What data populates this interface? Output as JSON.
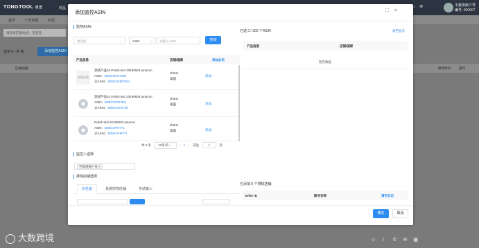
{
  "app": {
    "logo": "TONGTOOL",
    "logo_sub": "通途",
    "nav_item": "商品",
    "user_name": "不晨夜账户号",
    "user_id": "编号: 000007",
    "tabs": [
      "首页",
      "广告管理",
      "利润"
    ],
    "filter_placeholder": "请选择店铺/站点、可多选",
    "selected_count": "选中 0 / 共 条",
    "bulk_button": "添加监控ASIN",
    "table_header_store": "店铺/国家",
    "table_header_update": "更新时间",
    "table_header_action": "操作",
    "watermark": "大数跨境"
  },
  "modal": {
    "title": "添加监控ASIN",
    "section_asin": "监控ASIN",
    "store_select_placeholder": "请选择",
    "type_select_value": "ASIN",
    "asin_input_placeholder": "请输入ASIN",
    "search_button": "查询",
    "left_table": {
      "col_product": "产品信息",
      "col_store": "店铺/国家",
      "col_add_page": "添加此页",
      "rows": [
        {
          "thumb_text": "加载失败",
          "title": "测试产品02 Pulish test 20190826 amazon",
          "asin_label": "ASIN：",
          "asin": "B0BXSFMTWN",
          "sasin_label": "父ASIN：",
          "sasin": "B0BXSFMTWN",
          "store": "zhtest",
          "country": "美国",
          "action": "添加"
        },
        {
          "thumb_text": "",
          "title": "测试产品01 Pulish test 20190826 amazon",
          "asin_label": "ASIN：",
          "asin": "B0BXSGSF3K1",
          "sasin_label": "父ASIN：",
          "sasin": "B0BXSGSF3K",
          "store": "zhtest",
          "country": "美国",
          "action": "添加"
        },
        {
          "thumb_text": "",
          "title": "Pulish test 20190826 amazon",
          "asin_label": "ASIN：",
          "asin": "B0BXSFMT71",
          "sasin_label": "父ASIN：",
          "sasin": "B0BXSFMT7I",
          "store": "zhtest",
          "country": "美国",
          "action": "添加"
        }
      ]
    },
    "pagination": {
      "total": "共 8 条",
      "page_size": "20条/页",
      "prev": "‹",
      "current": "1",
      "next": "›",
      "goto": "前往",
      "goto_value": "1",
      "page_unit": "页"
    },
    "right_panel": {
      "selected_text": "已选 0 / 300 个ASIN",
      "clear_link": "清空此页",
      "col_product": "产品信息",
      "col_store": "店铺/国家",
      "empty": "暂无数据"
    },
    "section_monitor": "监控人选择",
    "monitor_tag": "不晨夜账户号",
    "section_exclude": "排除店铺选择",
    "exclude_tabs": [
      "白名单",
      "系统授权店铺",
      "手动输入"
    ],
    "exclude_right": {
      "added_text": "已添加 0 个排除店铺",
      "col_seller": "Seller ID",
      "col_name": "账号名称",
      "clear_link": "清空此页"
    },
    "confirm_button": "确定",
    "cancel_button": "取消"
  },
  "colors": {
    "primary": "#2d8cf0",
    "topbar": "#2b3440",
    "overlay": "#7a7a7a"
  }
}
